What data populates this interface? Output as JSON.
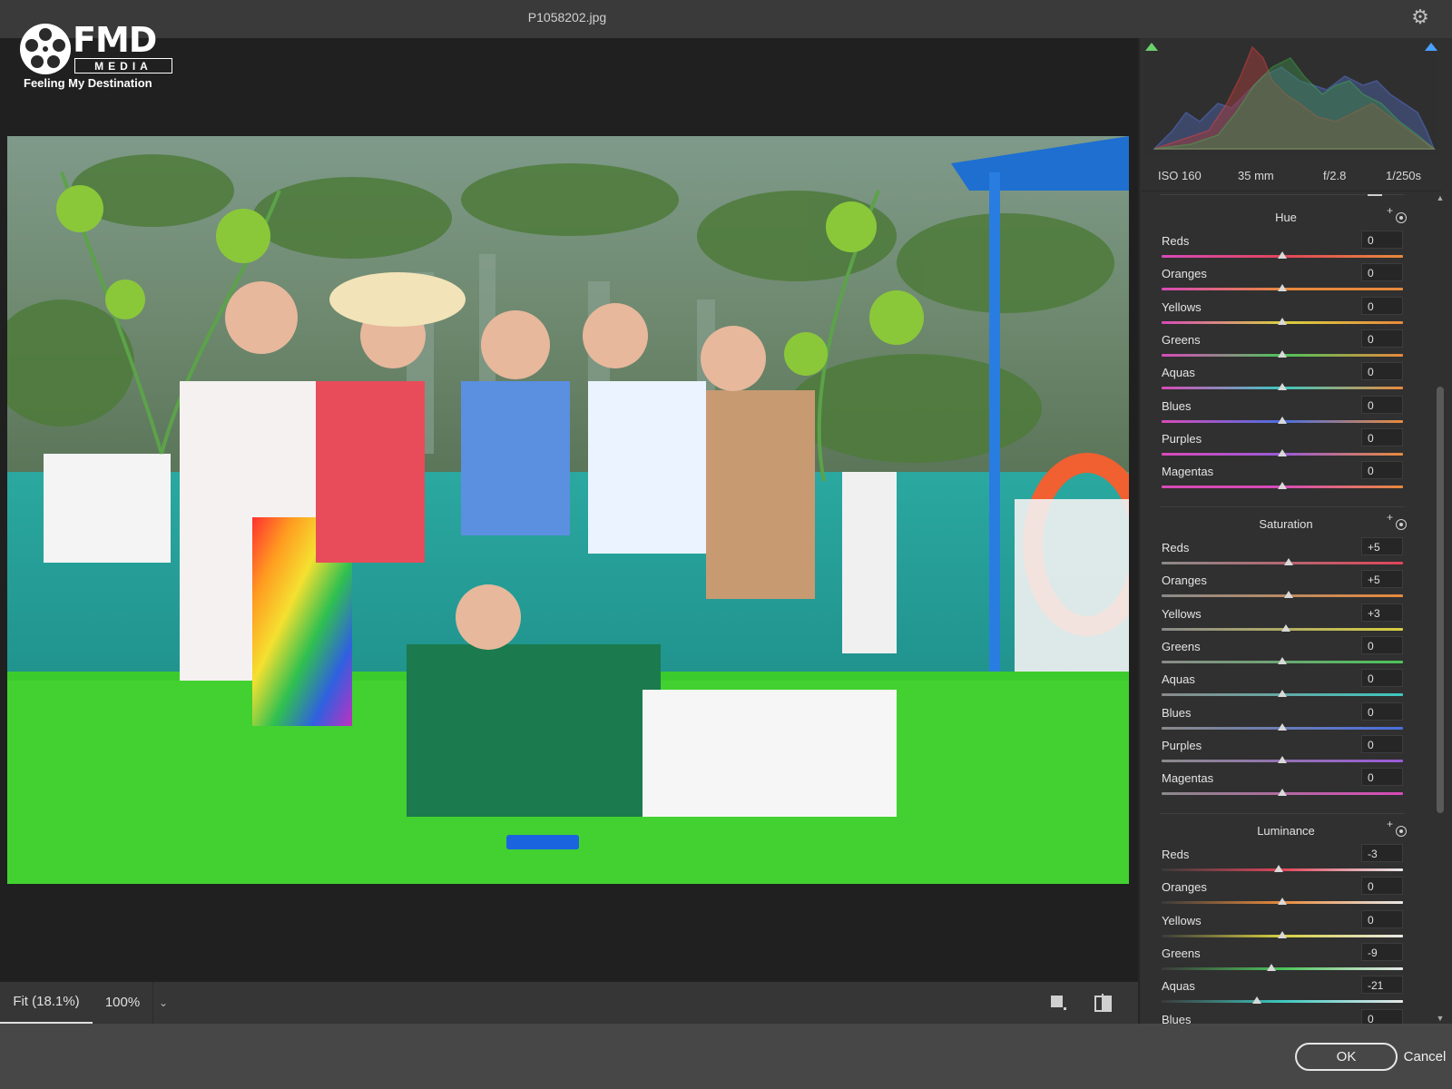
{
  "window": {
    "filename": "P1058202.jpg",
    "settings_icon": "gear-icon"
  },
  "logo": {
    "brand": "FMD",
    "sub": "MEDIA",
    "tagline": "Feeling My Destination"
  },
  "preview": {
    "description_icon": "photo",
    "zoom_fit": "Fit (18.1%)",
    "zoom_100": "100%",
    "zoom_dropdown_icon": "chevron-down-icon",
    "single_view_icon": "single-view-icon",
    "compare_view_icon": "before-after-icon"
  },
  "histogram": {
    "shadow_clipping_color": "#6ad06a",
    "highlight_clipping_color": "#4aa0ff"
  },
  "exif": {
    "iso": "ISO 160",
    "focal": "35 mm",
    "aperture": "f/2.8",
    "shutter": "1/250s"
  },
  "sections": [
    {
      "title": "Hue",
      "rows": [
        {
          "label": "Reds",
          "value": "0",
          "num": 0
        },
        {
          "label": "Oranges",
          "value": "0",
          "num": 0
        },
        {
          "label": "Yellows",
          "value": "0",
          "num": 0
        },
        {
          "label": "Greens",
          "value": "0",
          "num": 0
        },
        {
          "label": "Aquas",
          "value": "0",
          "num": 0
        },
        {
          "label": "Blues",
          "value": "0",
          "num": 0
        },
        {
          "label": "Purples",
          "value": "0",
          "num": 0
        },
        {
          "label": "Magentas",
          "value": "0",
          "num": 0
        }
      ]
    },
    {
      "title": "Saturation",
      "rows": [
        {
          "label": "Reds",
          "value": "+5",
          "num": 5
        },
        {
          "label": "Oranges",
          "value": "+5",
          "num": 5
        },
        {
          "label": "Yellows",
          "value": "+3",
          "num": 3
        },
        {
          "label": "Greens",
          "value": "0",
          "num": 0
        },
        {
          "label": "Aquas",
          "value": "0",
          "num": 0
        },
        {
          "label": "Blues",
          "value": "0",
          "num": 0
        },
        {
          "label": "Purples",
          "value": "0",
          "num": 0
        },
        {
          "label": "Magentas",
          "value": "0",
          "num": 0
        }
      ]
    },
    {
      "title": "Luminance",
      "rows": [
        {
          "label": "Reds",
          "value": "-3",
          "num": -3
        },
        {
          "label": "Oranges",
          "value": "0",
          "num": 0
        },
        {
          "label": "Yellows",
          "value": "0",
          "num": 0
        },
        {
          "label": "Greens",
          "value": "-9",
          "num": -9
        },
        {
          "label": "Aquas",
          "value": "-21",
          "num": -21
        },
        {
          "label": "Blues",
          "value": "0",
          "num": 0
        }
      ]
    }
  ],
  "slider_range": [
    -100,
    100
  ],
  "colors": {
    "Reds": "#e0455a",
    "Oranges": "#e88a3c",
    "Yellows": "#d8d040",
    "Greens": "#4cc45a",
    "Aquas": "#3ec8c0",
    "Blues": "#4a6ee0",
    "Purples": "#9a5ad8",
    "Magentas": "#d84ab8"
  },
  "footer": {
    "ok": "OK",
    "cancel": "Cancel"
  }
}
